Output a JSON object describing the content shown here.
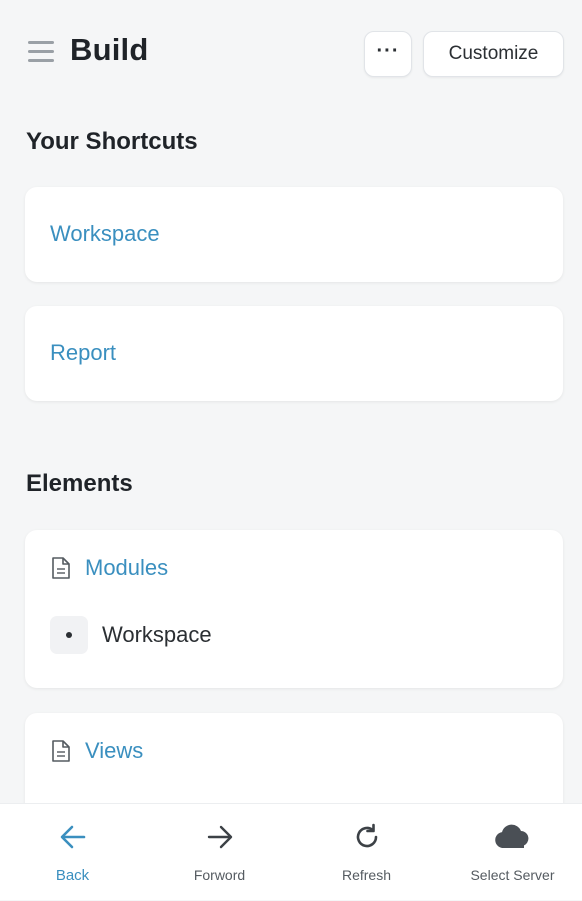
{
  "header": {
    "title": "Build",
    "more_label": "···",
    "customize_label": "Customize"
  },
  "shortcuts": {
    "title": "Your Shortcuts",
    "items": [
      {
        "label": "Workspace"
      },
      {
        "label": "Report"
      }
    ]
  },
  "elements": {
    "title": "Elements",
    "groups": [
      {
        "label": "Modules",
        "icon": "document-icon",
        "items": [
          "Workspace"
        ]
      },
      {
        "label": "Views",
        "icon": "document-icon",
        "items": []
      }
    ]
  },
  "bottom_nav": {
    "items": [
      {
        "label": "Back",
        "icon": "arrow-left-icon",
        "active": true
      },
      {
        "label": "Forword",
        "icon": "arrow-right-icon",
        "active": false
      },
      {
        "label": "Refresh",
        "icon": "refresh-icon",
        "active": false
      },
      {
        "label": "Select Server",
        "icon": "cloud-icon",
        "active": false
      }
    ]
  },
  "colors": {
    "accent": "#3a8fbf",
    "background": "#f5f6f7",
    "card": "#ffffff"
  }
}
